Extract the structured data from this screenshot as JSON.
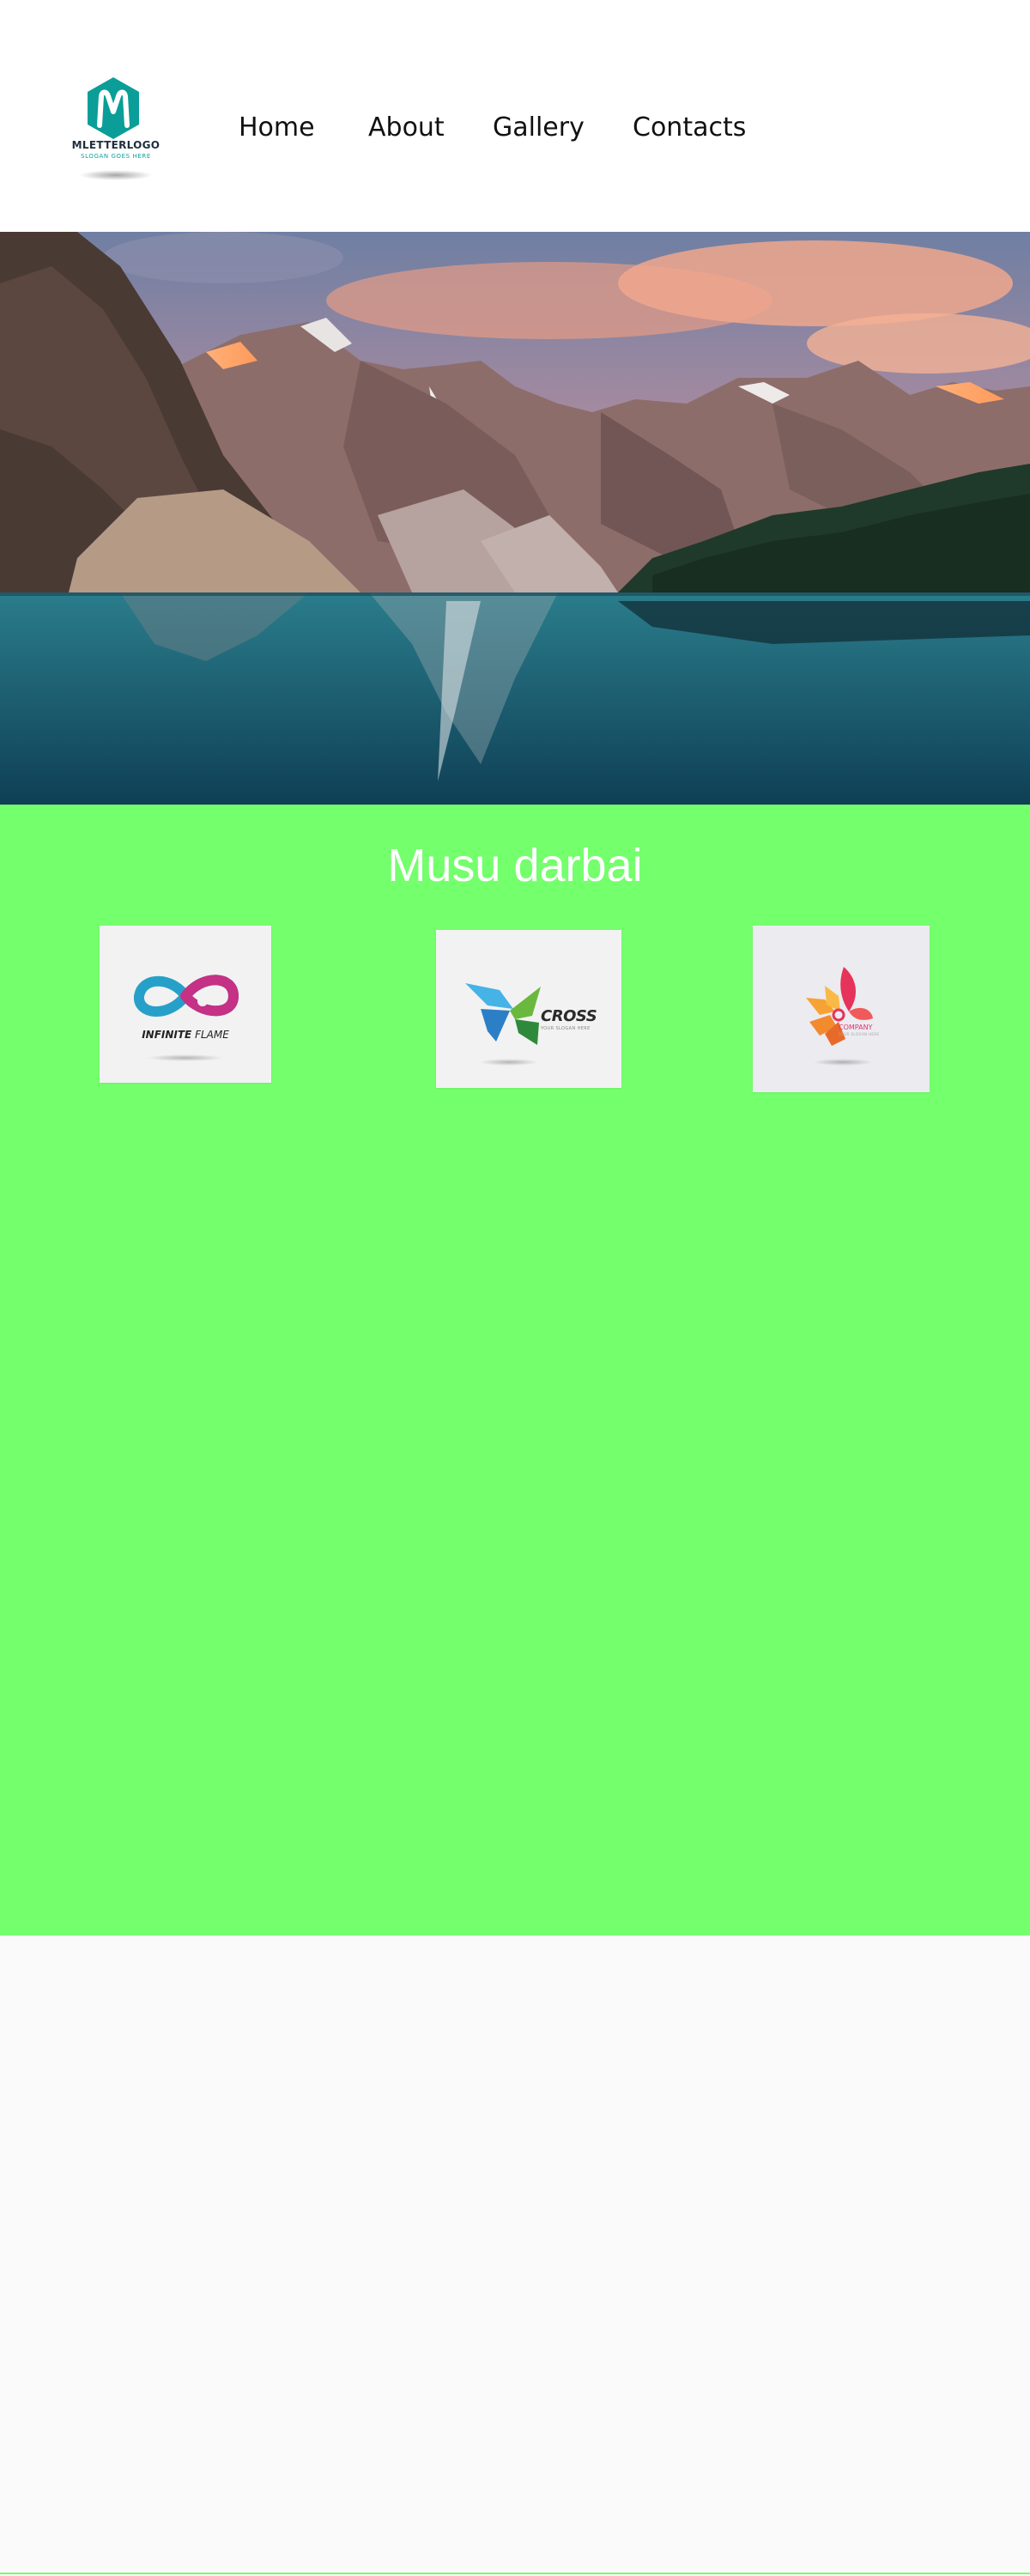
{
  "header": {
    "logo": {
      "name": "MLETTERLOGO",
      "slogan": "SLOGAN GOES HERE",
      "icon": "m-letter-hexagon-logo",
      "color": "#0b9e98"
    },
    "nav": [
      {
        "label": "Home"
      },
      {
        "label": "About"
      },
      {
        "label": "Gallery"
      },
      {
        "label": "Contacts"
      }
    ]
  },
  "hero": {
    "image": "mountain-lake-landscape"
  },
  "work": {
    "title": "Musu darbai",
    "background": "#74ff6c",
    "cards": [
      {
        "icon": "infinite-flame-logo",
        "label_bold": "INFINITE",
        "label_light": "FLAME"
      },
      {
        "icon": "cross-bird-logo",
        "label": "CROSS",
        "tagline": "YOUR SLOGAN HERE"
      },
      {
        "icon": "phoenix-company-logo",
        "label": "COMPANY",
        "tagline": "YOUR SLOGAN HERE"
      }
    ]
  },
  "footer": {
    "accent": "#74ff6c"
  }
}
